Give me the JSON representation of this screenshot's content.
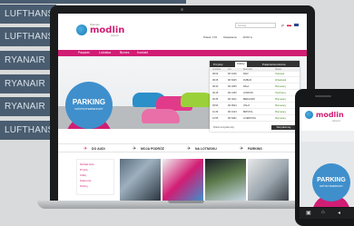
{
  "airline_list": {
    "rows": [
      "LUFTHANSA",
      "LUFTHANSA",
      "RYANAIR",
      "RYANAIR",
      "RYANAIR",
      "LUFTHANSA"
    ]
  },
  "site": {
    "logo": {
      "sub": "Warsaw",
      "name": "modlin",
      "tag": "Airport"
    },
    "search_placeholder": "Szukaj",
    "lang_label": "pl",
    "weather": {
      "temp": "Pokaz: 170",
      "city": "Ustawienia",
      "time": "10:00 w"
    },
    "nav": [
      "Pasażer",
      "Lotniska",
      "Biznes",
      "Kontakt"
    ]
  },
  "hero": {
    "title": "PARKING",
    "subtitle": "KRÓTKOTERMINOWY"
  },
  "flights": {
    "tabs": [
      "Przyloty",
      "Odloty",
      "Połączenia lotnicze"
    ],
    "headers": [
      "Godzina",
      "Lot",
      "Kierunek",
      "Status"
    ],
    "rows": [
      [
        "08:00",
        "FR 1046",
        "KIEV",
        "Odprawa"
      ],
      [
        "08:25",
        "FR 8425",
        "DUBLIN",
        "Wylądował"
      ],
      [
        "08:40",
        "FR 2065",
        "RIGA",
        "Planowany"
      ],
      [
        "09:15",
        "FR 1050",
        "LONDON",
        "Opóźniony"
      ],
      [
        "09:35",
        "FR 3021",
        "BERGAMO",
        "Planowany"
      ],
      [
        "09:50",
        "FR 9944",
        "OSLO",
        "Planowany"
      ],
      [
        "10:30",
        "FR 1043",
        "BRISTOL",
        "Planowany"
      ],
      [
        "10:55",
        "FR 8461",
        "LIVERPOOL",
        "Planowany"
      ]
    ],
    "more_link": "Pokaż wszystkie loty",
    "button": "Wszystkie loty"
  },
  "quick_bar": [
    "DO AUDI",
    "MOJA PODRÓŻ",
    "NA LOTNISKU",
    "PARKING"
  ],
  "side_links": [
    "Rozkład lotów",
    "Przyloty",
    "Odloty",
    "Połączenia",
    "Parking"
  ],
  "phone": {
    "logo": {
      "name": "modlin",
      "tag": "Airport"
    },
    "title": "PARKING",
    "subtitle": "KRÓTKOTERMINOWY"
  },
  "colors": {
    "brand_pink": "#d11d74",
    "brand_blue": "#3f8fcc",
    "nav_slate": "#4a5d70"
  }
}
